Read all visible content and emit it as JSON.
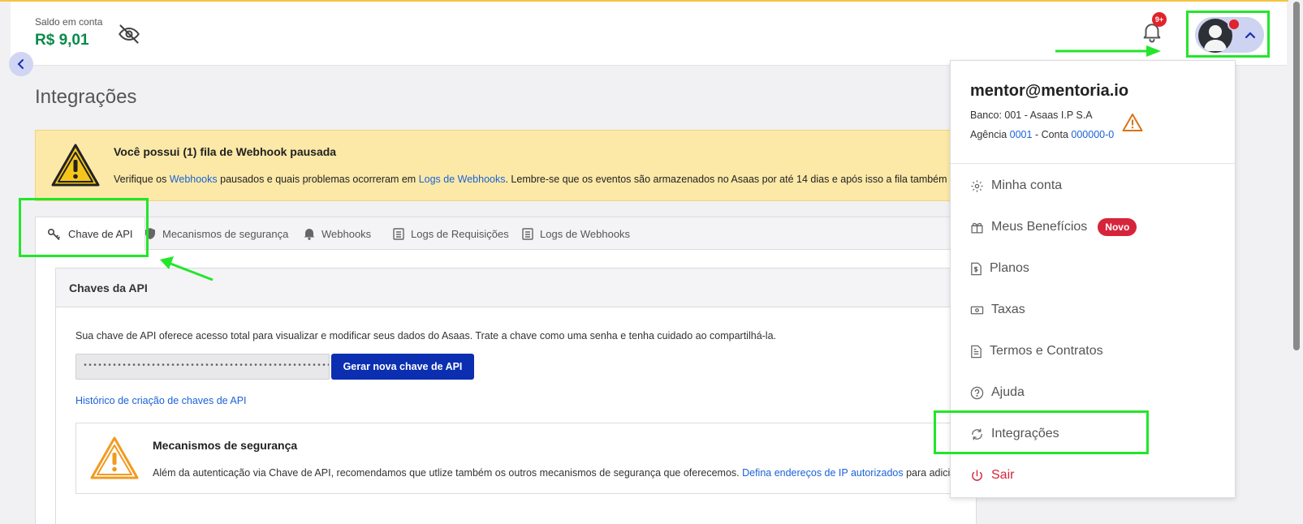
{
  "header": {
    "balance_label": "Saldo em conta",
    "balance_value": "R$ 9,01",
    "notifications_badge": "9+",
    "icons": [
      "eye-off-icon",
      "bell-icon",
      "chevron-up-icon"
    ]
  },
  "page": {
    "title": "Integrações"
  },
  "alert": {
    "title": "Você possui (1) fila de Webhook pausada",
    "text_part1": "Verifique os ",
    "link1": "Webhooks",
    "text_part2": " pausados e quais problemas ocorreram em ",
    "link2": "Logs de Webhooks",
    "text_part3": ". Lembre-se que os eventos são armazenados no Asaas por até 14 dias e após isso a fila também será p"
  },
  "tabs": [
    {
      "label": "Chave de API",
      "icon": "key-icon",
      "active": true
    },
    {
      "label": "Mecanismos de segurança",
      "icon": "shield-icon"
    },
    {
      "label": "Webhooks",
      "icon": "bell-icon"
    },
    {
      "label": "Logs de Requisições",
      "icon": "list-icon"
    },
    {
      "label": "Logs de Webhooks",
      "icon": "list-icon"
    }
  ],
  "api_keys": {
    "title": "Chaves da API",
    "description": "Sua chave de API oferece acesso total para visualizar e modificar seus dados do Asaas. Trate a chave como uma senha e tenha cuidado ao compartilhá-la.",
    "masked_key": "••••••••••••••••••••••••••••••••••••••••••••••••••••••",
    "generate_button": "Gerar nova chave de API",
    "history_link": "Histórico de criação de chaves de API"
  },
  "security": {
    "title": "Mecanismos de segurança",
    "text": "Além da autenticação via Chave de API, recomendamos que utlize também os outros mecanismos de segurança que oferecemos. ",
    "link": "Defina endereços de IP autorizados",
    "text_after": " para adicionar"
  },
  "dropdown": {
    "email": "mentor@mentoria.io",
    "bank": "Banco: 001 - Asaas I.P S.A",
    "agency_label": "Agência ",
    "agency_value": "0001",
    "account_label": " - Conta ",
    "account_value": "000000-0",
    "items": [
      {
        "label": "Minha conta",
        "icon": "gear-icon"
      },
      {
        "label": "Meus Benefícios",
        "icon": "gift-icon",
        "badge": "Novo"
      },
      {
        "label": "Planos",
        "icon": "document-dollar-icon"
      },
      {
        "label": "Taxas",
        "icon": "money-icon"
      },
      {
        "label": "Termos e Contratos",
        "icon": "document-icon"
      },
      {
        "label": "Ajuda",
        "icon": "help-icon"
      },
      {
        "label": "Integrações",
        "icon": "sync-icon"
      },
      {
        "label": "Sair",
        "icon": "power-icon"
      }
    ]
  },
  "colors": {
    "accent_blue": "#0b2fb0",
    "balance_green": "#0a8a4a",
    "alert_yellow": "#fce9a7",
    "danger_red": "#d6253b",
    "highlight_green": "#22e62a"
  }
}
